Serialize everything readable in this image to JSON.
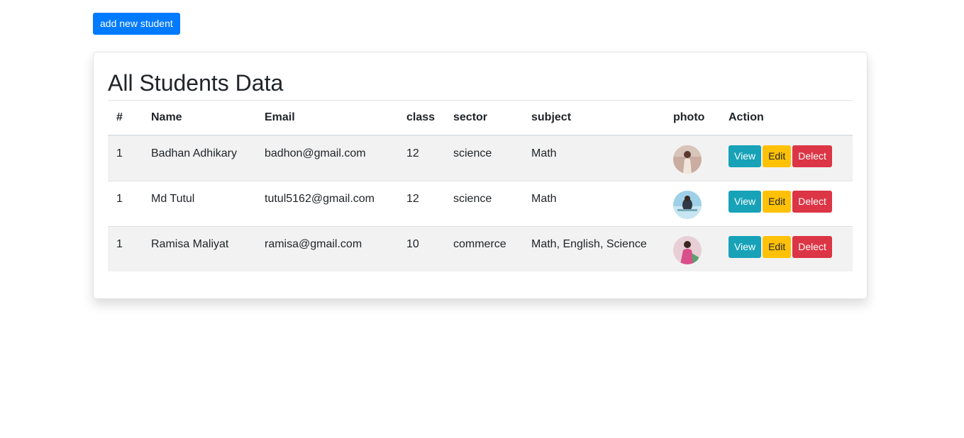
{
  "toolbar": {
    "add_label": "add new student"
  },
  "card": {
    "title": "All Students Data"
  },
  "table": {
    "headers": [
      "#",
      "Name",
      "Email",
      "class",
      "sector",
      "subject",
      "photo",
      "Action"
    ],
    "rows": [
      {
        "num": "1",
        "name": "Badhan Adhikary",
        "email": "badhon@gmail.com",
        "class": "12",
        "sector": "science",
        "subject": "Math",
        "photo": "student-photo-1"
      },
      {
        "num": "1",
        "name": "Md Tutul",
        "email": "tutul5162@gmail.com",
        "class": "12",
        "sector": "science",
        "subject": "Math",
        "photo": "student-photo-2"
      },
      {
        "num": "1",
        "name": "Ramisa Maliyat",
        "email": "ramisa@gmail.com",
        "class": "10",
        "sector": "commerce",
        "subject": "Math, English, Science",
        "photo": "student-photo-3"
      }
    ],
    "actions": {
      "view": "View",
      "edit": "Edit",
      "delete": "Delect"
    }
  },
  "colors": {
    "primary": "#007bff",
    "info": "#17a2b8",
    "warning": "#ffc107",
    "danger": "#dc3545"
  }
}
